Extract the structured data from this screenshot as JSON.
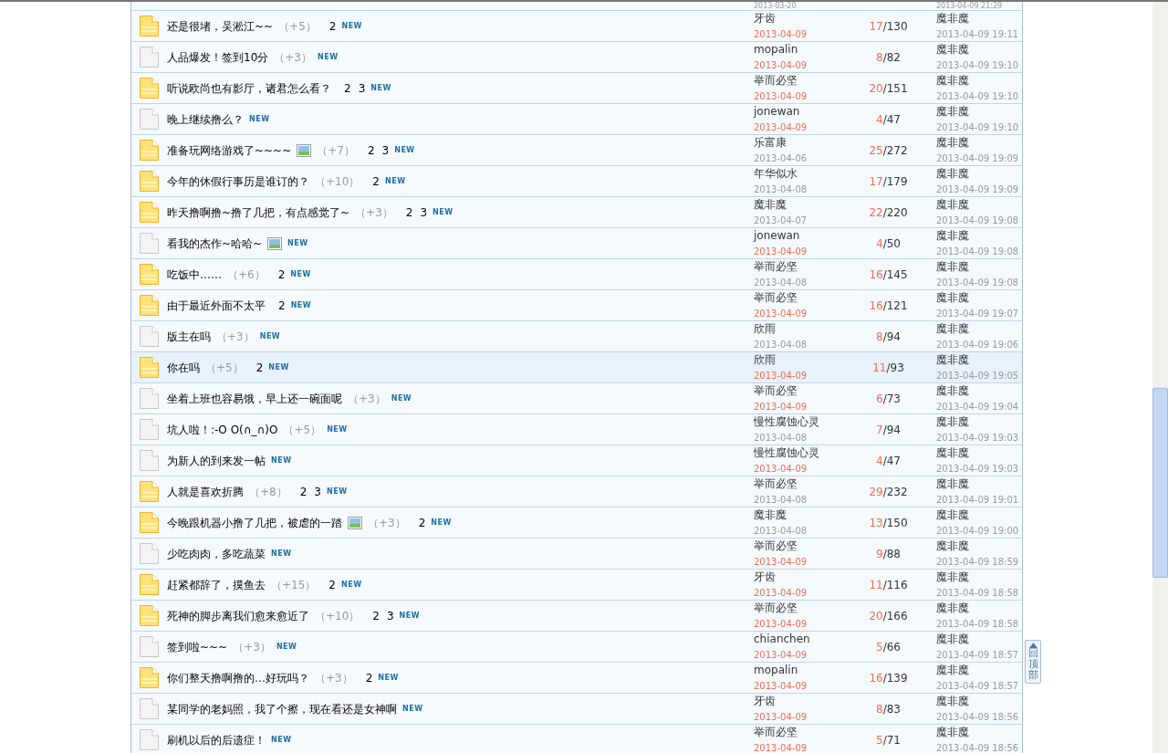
{
  "partial_row": {
    "author_date": "2013-03-20",
    "last_time": "2013-04-09 21:29"
  },
  "threads": [
    {
      "hot": true,
      "title": "还是很堵，吴淞江~~",
      "image": false,
      "bonus": "（+5）",
      "pages": [
        "2"
      ],
      "new_badge": "NEW",
      "author": "牙齿",
      "date": "2013-04-09",
      "recent": true,
      "replies": "17",
      "views": "/130",
      "last_author": "魔非魔",
      "last_time": "2013-04-09 19:11",
      "highlighted": false
    },
    {
      "hot": false,
      "title": "人品爆发！签到10分",
      "image": false,
      "bonus": "（+3）",
      "new_badge": "NEW",
      "author": "mopalin",
      "date": "2013-04-09",
      "recent": true,
      "replies": "8",
      "views": "/82",
      "last_author": "魔非魔",
      "last_time": "2013-04-09 19:10",
      "highlighted": false
    },
    {
      "hot": true,
      "title": "听说欧尚也有影厅，诸君怎么看？",
      "image": false,
      "pages": [
        "2",
        "3"
      ],
      "new_badge": "NEW",
      "author": "举而必坚",
      "date": "2013-04-09",
      "recent": true,
      "replies": "20",
      "views": "/151",
      "last_author": "魔非魔",
      "last_time": "2013-04-09 19:10",
      "highlighted": false
    },
    {
      "hot": false,
      "title": "晚上继续撸么？",
      "image": false,
      "new_badge": "NEW",
      "author": "jonewan",
      "date": "2013-04-09",
      "recent": true,
      "replies": "4",
      "views": "/47",
      "last_author": "魔非魔",
      "last_time": "2013-04-09 19:10",
      "highlighted": false
    },
    {
      "hot": true,
      "title": "准备玩网络游戏了~~~~",
      "image": true,
      "bonus": "（+7）",
      "pages": [
        "2",
        "3"
      ],
      "new_badge": "NEW",
      "author": "乐富康",
      "date": "2013-04-06",
      "recent": false,
      "replies": "25",
      "views": "/272",
      "last_author": "魔非魔",
      "last_time": "2013-04-09 19:09",
      "highlighted": false
    },
    {
      "hot": true,
      "title": "今年的休假行事历是谁订的？",
      "image": false,
      "bonus": "（+10）",
      "pages": [
        "2"
      ],
      "new_badge": "NEW",
      "author": "年华似水",
      "date": "2013-04-08",
      "recent": false,
      "replies": "17",
      "views": "/179",
      "last_author": "魔非魔",
      "last_time": "2013-04-09 19:09",
      "highlighted": false
    },
    {
      "hot": true,
      "title": "昨天撸啊撸~撸了几把，有点感觉了~",
      "image": false,
      "bonus": "（+3）",
      "pages": [
        "2",
        "3"
      ],
      "new_badge": "NEW",
      "author": "魔非魔",
      "date": "2013-04-07",
      "recent": false,
      "replies": "22",
      "views": "/220",
      "last_author": "魔非魔",
      "last_time": "2013-04-09 19:08",
      "highlighted": false
    },
    {
      "hot": false,
      "title": "看我的杰作~哈哈~",
      "image": true,
      "new_badge": "NEW",
      "author": "jonewan",
      "date": "2013-04-09",
      "recent": true,
      "replies": "4",
      "views": "/50",
      "last_author": "魔非魔",
      "last_time": "2013-04-09 19:08",
      "highlighted": false
    },
    {
      "hot": true,
      "title": "吃饭中……",
      "image": false,
      "bonus": "（+6）",
      "pages": [
        "2"
      ],
      "new_badge": "NEW",
      "author": "举而必坚",
      "date": "2013-04-08",
      "recent": false,
      "replies": "16",
      "views": "/145",
      "last_author": "魔非魔",
      "last_time": "2013-04-09 19:08",
      "highlighted": false
    },
    {
      "hot": true,
      "title": "由于最近外面不太平",
      "image": false,
      "pages": [
        "2"
      ],
      "new_badge": "NEW",
      "author": "举而必坚",
      "date": "2013-04-09",
      "recent": true,
      "replies": "16",
      "views": "/121",
      "last_author": "魔非魔",
      "last_time": "2013-04-09 19:07",
      "highlighted": false
    },
    {
      "hot": false,
      "title": "版主在吗",
      "image": false,
      "bonus": "（+3）",
      "new_badge": "NEW",
      "author": "欣雨",
      "date": "2013-04-08",
      "recent": false,
      "replies": "8",
      "views": "/94",
      "last_author": "魔非魔",
      "last_time": "2013-04-09 19:06",
      "highlighted": false
    },
    {
      "hot": true,
      "title": "你在吗",
      "image": false,
      "bonus": "（+5）",
      "pages": [
        "2"
      ],
      "new_badge": "NEW",
      "author": "欣雨",
      "date": "2013-04-09",
      "recent": true,
      "replies": "11",
      "views": "/93",
      "last_author": "魔非魔",
      "last_time": "2013-04-09 19:05",
      "highlighted": true
    },
    {
      "hot": false,
      "title": "坐着上班也容易饿，早上还一碗面呢",
      "image": false,
      "bonus": "（+3）",
      "new_badge": "NEW",
      "author": "举而必坚",
      "date": "2013-04-09",
      "recent": true,
      "replies": "6",
      "views": "/73",
      "last_author": "魔非魔",
      "last_time": "2013-04-09 19:04",
      "highlighted": false
    },
    {
      "hot": false,
      "title": "坑人啦！:-O  O(∩_∩)O",
      "image": false,
      "bonus": "（+5）",
      "new_badge": "NEW",
      "author": "慢性腐蚀心灵",
      "date": "2013-04-08",
      "recent": false,
      "replies": "7",
      "views": "/94",
      "last_author": "魔非魔",
      "last_time": "2013-04-09 19:03",
      "highlighted": false
    },
    {
      "hot": false,
      "title": "为新人的到来发一帖",
      "image": false,
      "new_badge": "NEW",
      "author": "慢性腐蚀心灵",
      "date": "2013-04-09",
      "recent": true,
      "replies": "4",
      "views": "/47",
      "last_author": "魔非魔",
      "last_time": "2013-04-09 19:03",
      "highlighted": false
    },
    {
      "hot": true,
      "title": "人就是喜欢折腾",
      "image": false,
      "bonus": "（+8）",
      "pages": [
        "2",
        "3"
      ],
      "new_badge": "NEW",
      "author": "举而必坚",
      "date": "2013-04-08",
      "recent": false,
      "replies": "29",
      "views": "/232",
      "last_author": "魔非魔",
      "last_time": "2013-04-09 19:01",
      "highlighted": false
    },
    {
      "hot": true,
      "title": "今晚跟机器小撸了几把，被虐的一踏",
      "image": true,
      "bonus": "（+3）",
      "pages": [
        "2"
      ],
      "new_badge": "NEW",
      "author": "魔非魔",
      "date": "2013-04-08",
      "recent": false,
      "replies": "13",
      "views": "/150",
      "last_author": "魔非魔",
      "last_time": "2013-04-09 19:00",
      "highlighted": false
    },
    {
      "hot": false,
      "title": "少吃肉肉，多吃蔬菜",
      "image": false,
      "new_badge": "NEW",
      "author": "举而必坚",
      "date": "2013-04-09",
      "recent": true,
      "replies": "9",
      "views": "/88",
      "last_author": "魔非魔",
      "last_time": "2013-04-09 18:59",
      "highlighted": false
    },
    {
      "hot": true,
      "title": "赶紧都辞了，摸鱼去",
      "image": false,
      "bonus": "（+15）",
      "pages": [
        "2"
      ],
      "new_badge": "NEW",
      "author": "牙齿",
      "date": "2013-04-09",
      "recent": true,
      "replies": "11",
      "views": "/116",
      "last_author": "魔非魔",
      "last_time": "2013-04-09 18:58",
      "highlighted": false
    },
    {
      "hot": true,
      "title": "死神的脚步离我们愈来愈近了",
      "image": false,
      "bonus": "（+10）",
      "pages": [
        "2",
        "3"
      ],
      "new_badge": "NEW",
      "author": "举而必坚",
      "date": "2013-04-09",
      "recent": true,
      "replies": "20",
      "views": "/166",
      "last_author": "魔非魔",
      "last_time": "2013-04-09 18:58",
      "highlighted": false
    },
    {
      "hot": false,
      "title": "签到啦~~~",
      "image": false,
      "bonus": "（+3）",
      "new_badge": "NEW",
      "author": "chianchen",
      "date": "2013-04-09",
      "recent": true,
      "replies": "5",
      "views": "/66",
      "last_author": "魔非魔",
      "last_time": "2013-04-09 18:57",
      "highlighted": false
    },
    {
      "hot": true,
      "title": "你们整天撸啊撸的…好玩吗？",
      "image": false,
      "bonus": "（+3）",
      "pages": [
        "2"
      ],
      "new_badge": "NEW",
      "author": "mopalin",
      "date": "2013-04-09",
      "recent": true,
      "replies": "16",
      "views": "/139",
      "last_author": "魔非魔",
      "last_time": "2013-04-09 18:57",
      "highlighted": false
    },
    {
      "hot": false,
      "title": "某同学的老妈照，我了个擦，现在看还是女神啊",
      "image": false,
      "new_badge": "NEW",
      "author": "牙齿",
      "date": "2013-04-09",
      "recent": true,
      "replies": "8",
      "views": "/83",
      "last_author": "魔非魔",
      "last_time": "2013-04-09 18:56",
      "highlighted": false
    },
    {
      "hot": false,
      "title": "刷机以后的后遗症！",
      "image": false,
      "new_badge": "NEW",
      "author": "举而必坚",
      "date": "2013-04-09",
      "recent": true,
      "replies": "5",
      "views": "/71",
      "last_author": "魔非魔",
      "last_time": "2013-04-09 18:56",
      "highlighted": false
    }
  ],
  "back_to_top": "回顶部"
}
